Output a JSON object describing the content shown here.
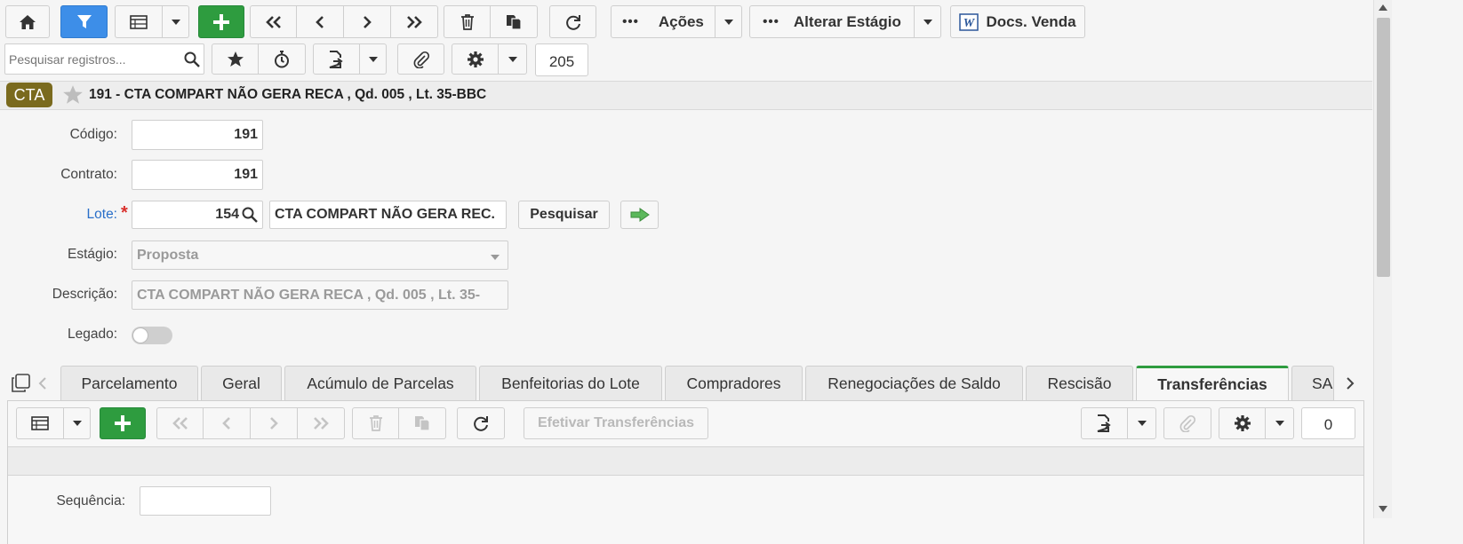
{
  "toolbar": {
    "acoes_label": "Ações",
    "alterar_estagio_label": "Alterar Estágio",
    "docs_venda_label": "Docs. Venda",
    "search_placeholder": "Pesquisar registros...",
    "record_count": "205"
  },
  "record": {
    "badge": "CTA",
    "title": "191 - CTA COMPART NÃO GERA RECA , Qd. 005 , Lt. 35-BBC"
  },
  "form": {
    "codigo_label": "Código:",
    "codigo_value": "191",
    "contrato_label": "Contrato:",
    "contrato_value": "191",
    "lote_label": "Lote:",
    "lote_required": "*",
    "lote_value": "154",
    "lote_desc": "CTA COMPART NÃO GERA REC.",
    "pesquisar_label": "Pesquisar",
    "estagio_label": "Estágio:",
    "estagio_value": "Proposta",
    "descricao_label": "Descrição:",
    "descricao_value": "CTA COMPART NÃO GERA RECA ,  Qd. 005 ,  Lt. 35-",
    "legado_label": "Legado:",
    "legado_on": false
  },
  "tabs": [
    {
      "label": "Parcelamento"
    },
    {
      "label": "Geral"
    },
    {
      "label": "Acúmulo de Parcelas"
    },
    {
      "label": "Benfeitorias do Lote"
    },
    {
      "label": "Compradores"
    },
    {
      "label": "Renegociações de Saldo"
    },
    {
      "label": "Rescisão"
    },
    {
      "label": "Transferências"
    },
    {
      "label": "SA"
    }
  ],
  "active_tab": "Transferências",
  "subtoolbar": {
    "efetivar_label": "Efetivar Transferências",
    "count": "0"
  },
  "subform": {
    "sequencia_label": "Sequência:",
    "sequencia_value": ""
  },
  "colors": {
    "accent_blue": "#3d8ee8",
    "accent_green": "#2e9c3f",
    "badge": "#7a6a1e",
    "link_label": "#2a6fc9",
    "required": "#d9302c"
  }
}
